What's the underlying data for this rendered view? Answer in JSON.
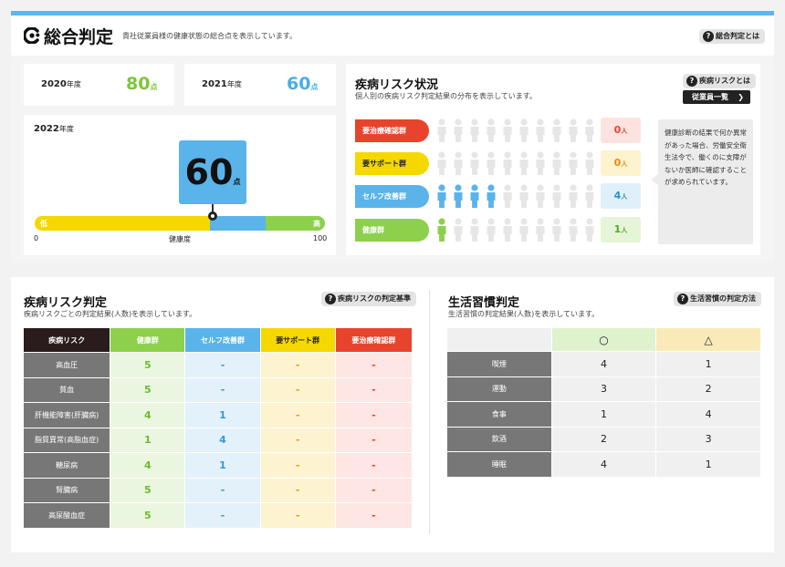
{
  "header": {
    "title": "総合判定",
    "subtitle": "貴社従業員様の健康状態の総合点を表示しています。",
    "help_label": "総合判定とは"
  },
  "scores": {
    "y2020": {
      "year": "2020",
      "suffix": "年度",
      "value": "80",
      "unit": "点",
      "color": "#7cc63a"
    },
    "y2021": {
      "year": "2021",
      "suffix": "年度",
      "value": "60",
      "unit": "点",
      "color": "#4aaee8"
    },
    "y2022": {
      "year": "2022",
      "suffix": "年度",
      "value": "60",
      "unit": "点"
    }
  },
  "gauge": {
    "low": "低",
    "high": "高",
    "min": "0",
    "max": "100",
    "label": "健康度",
    "value": 60
  },
  "risk_status": {
    "title": "疾病リスク状況",
    "subtitle": "個人別の疾病リスク判定結果の分布を表示しています。",
    "help_label": "疾病リスクとは",
    "list_button": "従業員一覧",
    "groups": [
      {
        "label": "要治療確認群",
        "count": "0",
        "unit": "人",
        "color": "#e8432d",
        "text": "#ffffff",
        "box_bg": "#fde3e0",
        "box_fg": "#e8432d",
        "filled": 0
      },
      {
        "label": "要サポート群",
        "count": "0",
        "unit": "人",
        "color": "#f4d800",
        "text": "#222222",
        "box_bg": "#fdf3cf",
        "box_fg": "#e88a10",
        "filled": 0
      },
      {
        "label": "セルフ改善群",
        "count": "4",
        "unit": "人",
        "color": "#5ab4ea",
        "text": "#ffffff",
        "box_bg": "#dff0fb",
        "box_fg": "#2f8fd0",
        "filled": 4
      },
      {
        "label": "健康群",
        "count": "1",
        "unit": "人",
        "color": "#8cd04c",
        "text": "#ffffff",
        "box_bg": "#e6f5d8",
        "box_fg": "#5aa624",
        "filled": 1
      }
    ],
    "note": "健康診断の結果で何か異常があった場合、労働安全衛生法令で、働くのに支障がないか医師に確認することが求められています。"
  },
  "disease_table": {
    "title": "疾病リスク判定",
    "subtitle": "疾病リスクごとの判定結果(人数)を表示しています。",
    "help_label": "疾病リスクの判定基準",
    "columns": [
      "疾病リスク",
      "健康群",
      "セルフ改善群",
      "要サポート群",
      "要治療確認群"
    ],
    "rows": [
      [
        "高血圧",
        "5",
        "-",
        "-",
        "-"
      ],
      [
        "貧血",
        "5",
        "-",
        "-",
        "-"
      ],
      [
        "肝機能障害(肝臓病)",
        "4",
        "1",
        "-",
        "-"
      ],
      [
        "脂質異常(高脂血症)",
        "1",
        "4",
        "-",
        "-"
      ],
      [
        "糖尿病",
        "4",
        "1",
        "-",
        "-"
      ],
      [
        "腎臓病",
        "5",
        "-",
        "-",
        "-"
      ],
      [
        "高尿酸血症",
        "5",
        "-",
        "-",
        "-"
      ]
    ]
  },
  "lifestyle_table": {
    "title": "生活習慣判定",
    "subtitle": "生活習慣の判定結果(人数)を表示しています。",
    "help_label": "生活習慣の判定方法",
    "columns": [
      "",
      "○",
      "△"
    ],
    "rows": [
      [
        "喫煙",
        "4",
        "1"
      ],
      [
        "運動",
        "3",
        "2"
      ],
      [
        "食事",
        "1",
        "4"
      ],
      [
        "飲酒",
        "2",
        "3"
      ],
      [
        "睡眠",
        "4",
        "1"
      ]
    ]
  }
}
